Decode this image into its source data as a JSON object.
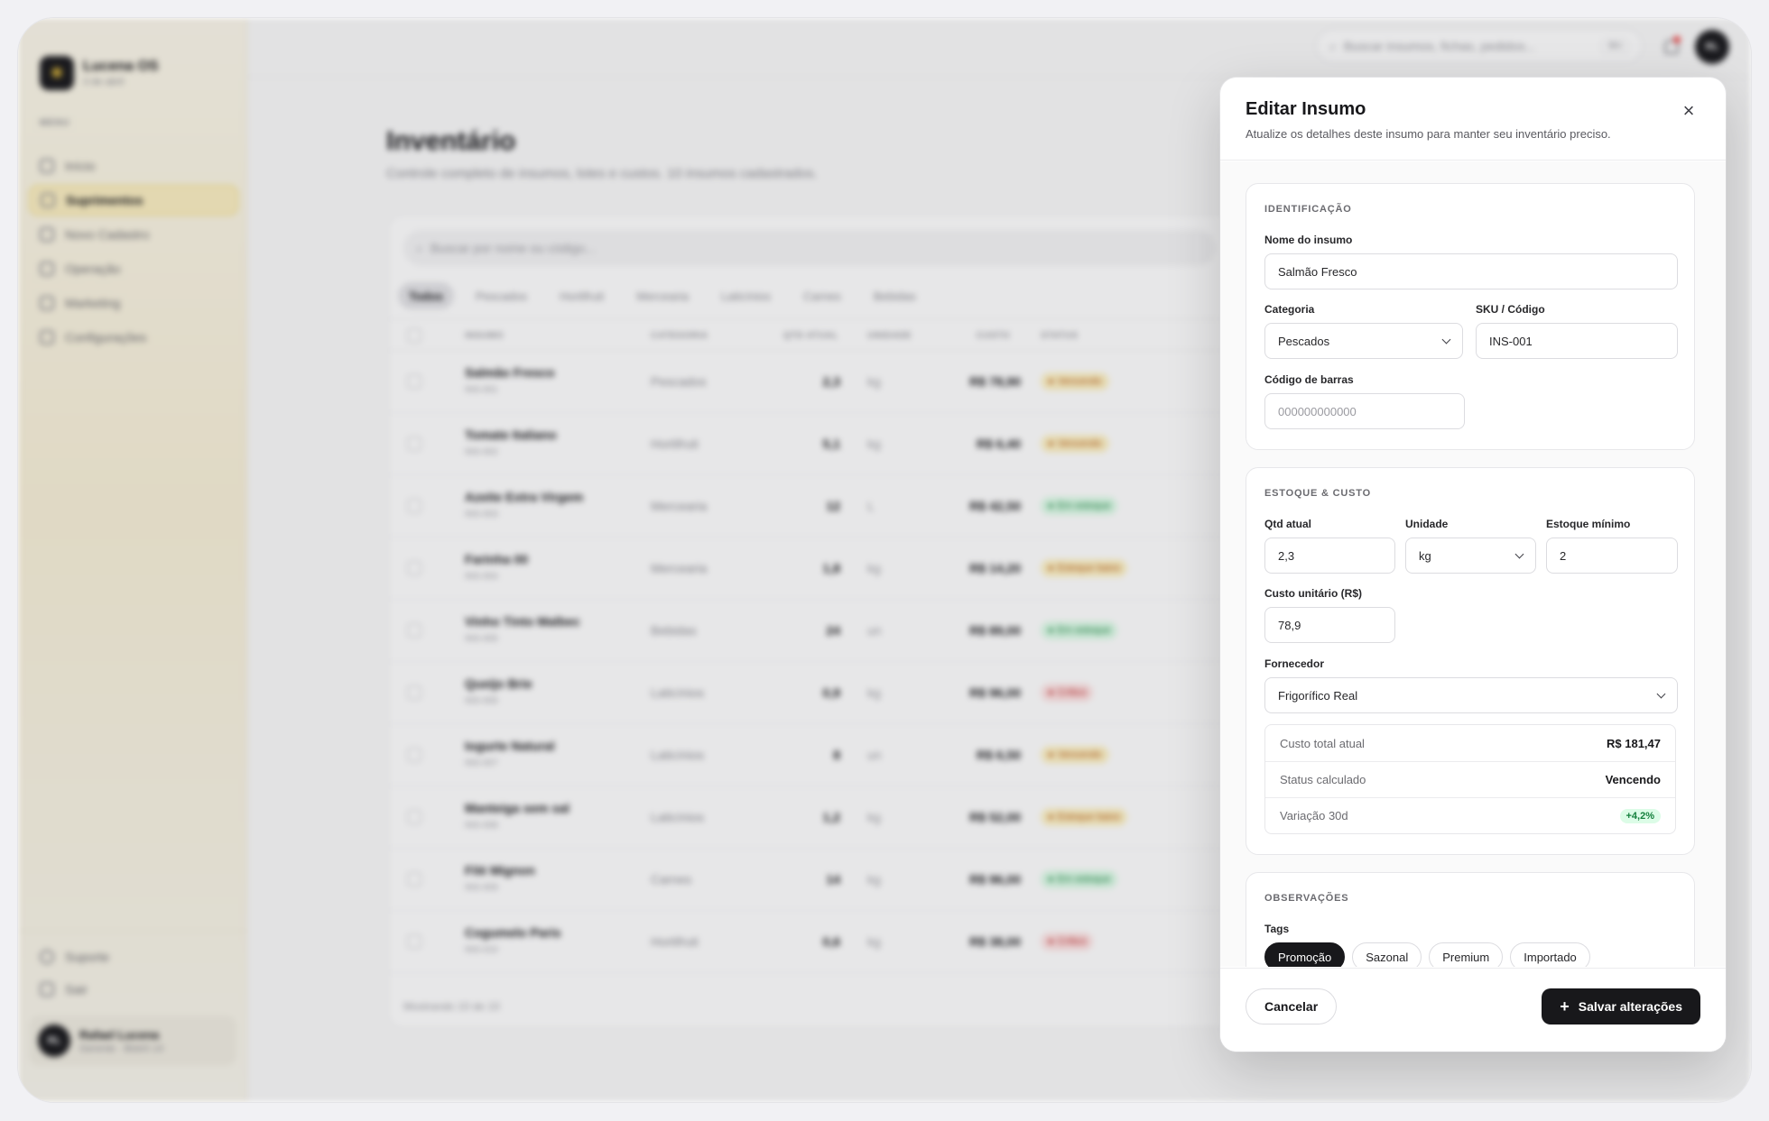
{
  "brand": {
    "name": "Lucena OS",
    "date": "3 de abril"
  },
  "sidebar": {
    "menu_label": "MENU",
    "items": [
      {
        "label": "Início"
      },
      {
        "label": "Suprimentos"
      },
      {
        "label": "Novo Cadastro"
      },
      {
        "label": "Operação"
      },
      {
        "label": "Marketing"
      },
      {
        "label": "Configurações"
      }
    ],
    "support": "Suporte",
    "logout": "Sair",
    "user": {
      "initials": "RL",
      "name": "Rafael Lucena",
      "role": "Gerente · Bistrô 14"
    }
  },
  "topbar": {
    "search_placeholder": "Buscar insumos, fichas, pedidos...",
    "shortcut": "⌘K",
    "avatar_initials": "RL"
  },
  "page": {
    "title": "Inventário",
    "subtitle": "Controle completo de insumos, lotes e custos. 10 insumos cadastrados.",
    "table_search_placeholder": "Buscar por nome ou código...",
    "filters": [
      "Todos",
      "Pescados",
      "Hortifruti",
      "Mercearia",
      "Laticínios",
      "Carnes",
      "Bebidas"
    ],
    "columns": [
      "INSUMO",
      "CATEGORIA",
      "QTD ATUAL",
      "UNIDADE",
      "CUSTO",
      "STATUS"
    ],
    "rows": [
      {
        "name": "Salmão Fresco",
        "sku": "INS-001",
        "category": "Pescados",
        "qty": "2,3",
        "unit": "kg",
        "cost": "R$ 78,90",
        "status": "Vencendo",
        "status_kind": "warn"
      },
      {
        "name": "Tomate Italiano",
        "sku": "INS-002",
        "category": "Hortifruti",
        "qty": "5,1",
        "unit": "kg",
        "cost": "R$ 6,40",
        "status": "Vencendo",
        "status_kind": "warn"
      },
      {
        "name": "Azeite Extra Virgem",
        "sku": "INS-003",
        "category": "Mercearia",
        "qty": "12",
        "unit": "L",
        "cost": "R$ 42,50",
        "status": "Em estoque",
        "status_kind": "ok"
      },
      {
        "name": "Farinha 00",
        "sku": "INS-004",
        "category": "Mercearia",
        "qty": "1,8",
        "unit": "kg",
        "cost": "R$ 14,20",
        "status": "Estoque baixo",
        "status_kind": "warn"
      },
      {
        "name": "Vinho Tinto Malbec",
        "sku": "INS-005",
        "category": "Bebidas",
        "qty": "24",
        "unit": "un",
        "cost": "R$ 89,00",
        "status": "Em estoque",
        "status_kind": "ok"
      },
      {
        "name": "Queijo Brie",
        "sku": "INS-006",
        "category": "Laticínios",
        "qty": "0,9",
        "unit": "kg",
        "cost": "R$ 96,00",
        "status": "Crítico",
        "status_kind": "crit"
      },
      {
        "name": "Iogurte Natural",
        "sku": "INS-007",
        "category": "Laticínios",
        "qty": "8",
        "unit": "un",
        "cost": "R$ 6,50",
        "status": "Vencendo",
        "status_kind": "warn"
      },
      {
        "name": "Manteiga sem sal",
        "sku": "INS-008",
        "category": "Laticínios",
        "qty": "1,2",
        "unit": "kg",
        "cost": "R$ 52,00",
        "status": "Estoque baixo",
        "status_kind": "warn"
      },
      {
        "name": "Filé Mignon",
        "sku": "INS-009",
        "category": "Carnes",
        "qty": "14",
        "unit": "kg",
        "cost": "R$ 96,00",
        "status": "Em estoque",
        "status_kind": "ok"
      },
      {
        "name": "Cogumelo Paris",
        "sku": "INS-010",
        "category": "Hortifruti",
        "qty": "0,6",
        "unit": "kg",
        "cost": "R$ 38,00",
        "status": "Crítico",
        "status_kind": "crit"
      }
    ],
    "footer": "Mostrando 10 de 10"
  },
  "drawer": {
    "title": "Editar Insumo",
    "subtitle": "Atualize os detalhes deste insumo para manter seu inventário preciso.",
    "sections": {
      "identificacao": {
        "title": "IDENTIFICAÇÃO",
        "name_label": "Nome do insumo",
        "name_value": "Salmão Fresco",
        "category_label": "Categoria",
        "category_value": "Pescados",
        "sku_label": "SKU / Código",
        "sku_value": "INS-001",
        "barcode_label": "Código de barras",
        "barcode_placeholder": "000000000000"
      },
      "estoque": {
        "title": "ESTOQUE & CUSTO",
        "qty_label": "Qtd atual",
        "qty_value": "2,3",
        "unit_label": "Unidade",
        "unit_value": "kg",
        "min_label": "Estoque mínimo",
        "min_value": "2",
        "cost_label": "Custo unitário (R$)",
        "cost_value": "78,9",
        "supplier_label": "Fornecedor",
        "supplier_value": "Frigorífico Real",
        "summary": [
          {
            "label": "Custo total atual",
            "value": "R$ 181,47"
          },
          {
            "label": "Status calculado",
            "value": "Vencendo"
          },
          {
            "label": "Variação 30d",
            "value": "+4,2%"
          }
        ]
      },
      "observacoes": {
        "title": "OBSERVAÇÕES",
        "tags_label": "Tags",
        "tags": [
          "Promoção",
          "Sazonal",
          "Premium",
          "Importado"
        ]
      }
    },
    "cancel_label": "Cancelar",
    "save_label": "Salvar alterações"
  },
  "colors": {
    "accent": "#18181b",
    "brand_gold": "#d7b43b",
    "active_nav": "#fbefc2",
    "success": "#15803d"
  }
}
